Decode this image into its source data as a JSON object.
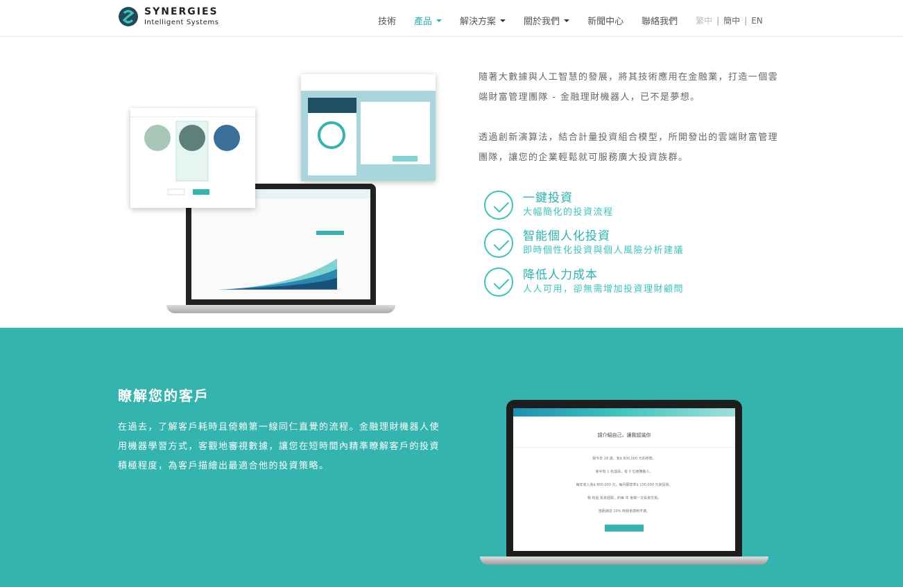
{
  "brand": {
    "title": "SYNERGIES",
    "subtitle": "Intelligent Systems",
    "accent": "#2ab3ad",
    "teal": "#34b4ae"
  },
  "nav": {
    "items": [
      {
        "label": "技術",
        "has_caret": false
      },
      {
        "label": "產品",
        "has_caret": true,
        "active": true
      },
      {
        "label": "解決方案",
        "has_caret": true
      },
      {
        "label": "關於我們",
        "has_caret": true
      },
      {
        "label": "新聞中心",
        "has_caret": false
      },
      {
        "label": "聯絡我們",
        "has_caret": false
      }
    ],
    "lang": {
      "zh_tw": "繁中",
      "zh_cn": "簡中",
      "en": "EN"
    }
  },
  "intro": {
    "para1": "隨著大數據與人工智慧的發展，將其技術應用在金融業，打造一個雲端財富管理團隊 - 金融理財機器人，已不是夢想。",
    "para2": "透過創新演算法，結合計量投資組合模型，所開發出的雲端財富管理團隊，讓您的企業輕鬆就可服務廣大投資族群。"
  },
  "features": [
    {
      "title": "一鍵投資",
      "subtitle": "大幅簡化的投資流程"
    },
    {
      "title": "智能個人化投資",
      "subtitle": "即時個性化投資與個人風險分析建議"
    },
    {
      "title": "降低人力成本",
      "subtitle": "人人可用，卻無需增加投資理財顧問"
    }
  ],
  "section2": {
    "title": "瞭解您的客戶",
    "text": "在過去，了解客戶耗時且倚賴第一線同仁直覺的流程。金融理財機器人使用機器學習方式，客觀地審視數據，讓您在短時間內精準瞭解客戶的投資積極程度，為客戶描繪出最適合他的投資策略。"
  },
  "mock2": {
    "form_title": "請介紹自己，讓我認識你",
    "lines": [
      "我今年 28 歲，有$ 800,000 元的存款。",
      "家中有 1 名成員，有 0 位被撫養人。",
      "每年收入為$ 800,000 元，每月願意拿$ 100,000 元來投資。",
      "我 有過 投資經驗，約每 年 會做一次投資交易。",
      "當虧損達 20% 時我會感到不適。"
    ]
  }
}
